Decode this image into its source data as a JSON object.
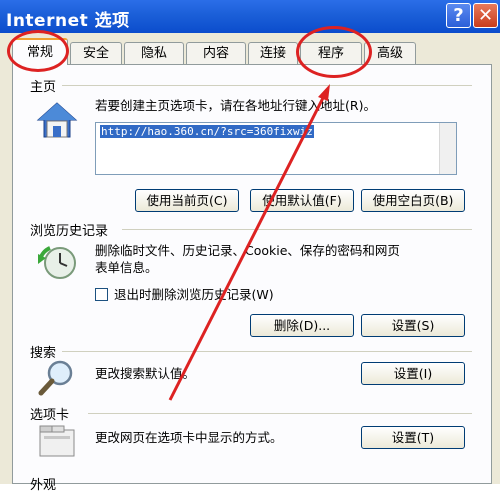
{
  "window": {
    "title": "Internet 选项",
    "help_label": "?",
    "close_label": "✕"
  },
  "tabs": [
    {
      "label": "常规",
      "active": true
    },
    {
      "label": "安全"
    },
    {
      "label": "隐私"
    },
    {
      "label": "内容"
    },
    {
      "label": "连接"
    },
    {
      "label": "程序"
    },
    {
      "label": "高级"
    }
  ],
  "homepage": {
    "section_title": "主页",
    "icon": "house-icon",
    "instruction": "若要创建主页选项卡，请在各地址行键入地址(R)。",
    "url": "http://hao.360.cn/?src=360fixwiz",
    "buttons": {
      "use_current": "使用当前页(C)",
      "use_default": "使用默认值(F)",
      "use_blank": "使用空白页(B)"
    }
  },
  "history": {
    "section_title": "浏览历史记录",
    "icon": "history-clock-icon",
    "description_line1": "删除临时文件、历史记录、Cookie、保存的密码和网页",
    "description_line2": "表单信息。",
    "checkbox_label": "退出时删除浏览历史记录(W)",
    "checkbox_checked": false,
    "delete_label": "删除(D)...",
    "settings_label": "设置(S)"
  },
  "search": {
    "section_title": "搜索",
    "icon": "magnifier-icon",
    "description": "更改搜索默认值。",
    "settings_label": "设置(I)"
  },
  "tabs_section": {
    "section_title": "选项卡",
    "icon": "tabs-window-icon",
    "description": "更改网页在选项卡中显示的方式。",
    "settings_label": "设置(T)"
  },
  "appearance": {
    "section_title": "外观"
  },
  "colors": {
    "annotation": "#dd2222",
    "titlebar": "#1b5fd8",
    "dialog_bg": "#ece9d8"
  }
}
